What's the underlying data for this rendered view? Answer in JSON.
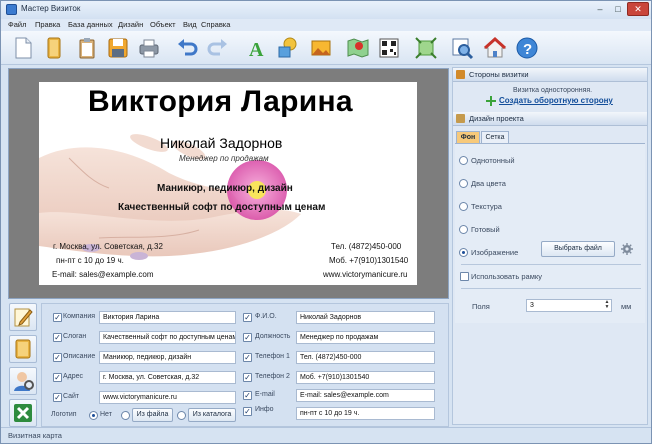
{
  "window": {
    "title": "Мастер Визиток"
  },
  "menu": [
    "Файл",
    "Правка",
    "База данных",
    "Дизайн",
    "Объект",
    "Вид",
    "Справка"
  ],
  "card": {
    "company": "Виктория Ларина",
    "fio": "Николай Задорнов",
    "position": "Менеджер по продажам",
    "description": "Маникюр, педикюр, дизайн",
    "slogan": "Качественный софт по доступным ценам",
    "address": "г. Москва, ул. Советская, д.32",
    "info": "пн-пт с 10 до 19 ч.",
    "email": "E-mail: sales@example.com",
    "phone1": "Тел. (4872)450-000",
    "phone2": "Моб. +7(910)1301540",
    "site": "www.victorymanicure.ru"
  },
  "fields": {
    "left": [
      {
        "label": "Компания",
        "value": "Виктория Ларина"
      },
      {
        "label": "Слоган",
        "value": "Качественный софт по доступным ценам"
      },
      {
        "label": "Описание",
        "value": "Маникюр, педикюр, дизайн"
      },
      {
        "label": "Адрес",
        "value": "г. Москва, ул. Советская, д.32"
      },
      {
        "label": "Сайт",
        "value": "www.victorymanicure.ru"
      }
    ],
    "right": [
      {
        "label": "Ф.И.О.",
        "value": "Николай Задорнов"
      },
      {
        "label": "Должность",
        "value": "Менеджер по продажам"
      },
      {
        "label": "Телефон 1",
        "value": "Тел. (4872)450-000"
      },
      {
        "label": "Телефон 2",
        "value": "Моб. +7(910)1301540"
      },
      {
        "label": "E-mail",
        "value": "E-mail: sales@example.com"
      },
      {
        "label": "Инфо",
        "value": "пн-пт с 10 до 19 ч."
      }
    ],
    "logo": {
      "label": "Логотип",
      "none": "Нет",
      "from_file": "Из файла",
      "from_catalog": "Из каталога"
    }
  },
  "panel": {
    "sides_title": "Стороны визитки",
    "sides_info": "Визитка односторонняя.",
    "create_back": "Создать оборотную сторону",
    "design_title": "Дизайн проекта",
    "tabs": [
      "Фон",
      "Сетка"
    ],
    "options": [
      "Однотонный",
      "Два цвета",
      "Текстура",
      "Готовый",
      "Изображение"
    ],
    "choose_file": "Выбрать файл",
    "use_frame": "Использовать рамку",
    "margins_label": "Поля",
    "margins_value": "3",
    "margins_unit": "мм"
  },
  "status": "Визитная карта",
  "colors": {
    "accent": "#f7c97a",
    "link": "#134e9a",
    "chrome": "#d6e3f2"
  }
}
